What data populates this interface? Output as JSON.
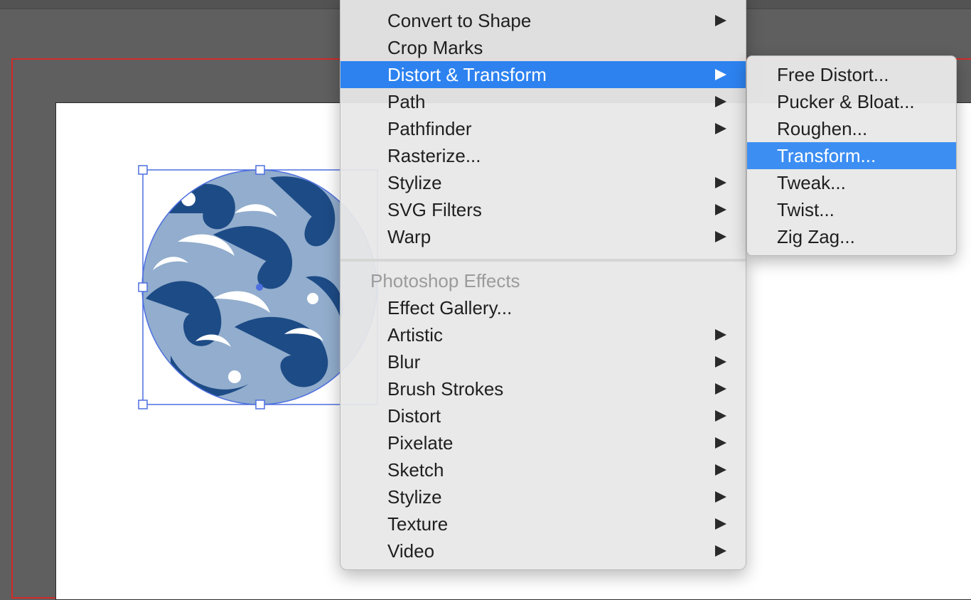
{
  "effect_menu": {
    "illustrator_items": [
      {
        "label": "Convert to Shape",
        "has_submenu": true
      },
      {
        "label": "Crop Marks",
        "has_submenu": false
      },
      {
        "label": "Distort & Transform",
        "has_submenu": true,
        "highlighted": true
      },
      {
        "label": "Path",
        "has_submenu": true
      },
      {
        "label": "Pathfinder",
        "has_submenu": true
      },
      {
        "label": "Rasterize...",
        "has_submenu": false
      },
      {
        "label": "Stylize",
        "has_submenu": true
      },
      {
        "label": "SVG Filters",
        "has_submenu": true
      },
      {
        "label": "Warp",
        "has_submenu": true
      }
    ],
    "photoshop_header": "Photoshop Effects",
    "photoshop_items": [
      {
        "label": "Effect Gallery...",
        "has_submenu": false
      },
      {
        "label": "Artistic",
        "has_submenu": true
      },
      {
        "label": "Blur",
        "has_submenu": true
      },
      {
        "label": "Brush Strokes",
        "has_submenu": true
      },
      {
        "label": "Distort",
        "has_submenu": true
      },
      {
        "label": "Pixelate",
        "has_submenu": true
      },
      {
        "label": "Sketch",
        "has_submenu": true
      },
      {
        "label": "Stylize",
        "has_submenu": true
      },
      {
        "label": "Texture",
        "has_submenu": true
      },
      {
        "label": "Video",
        "has_submenu": true
      }
    ]
  },
  "distort_submenu": {
    "items": [
      {
        "label": "Free Distort..."
      },
      {
        "label": "Pucker & Bloat..."
      },
      {
        "label": "Roughen..."
      },
      {
        "label": "Transform...",
        "highlighted": true
      },
      {
        "label": "Tweak..."
      },
      {
        "label": "Twist..."
      },
      {
        "label": "Zig Zag..."
      }
    ]
  },
  "colors": {
    "highlight": "#2d82f0",
    "bleed_guide": "#d42a2a",
    "selection": "#4d6fe0",
    "pattern_dark": "#1d4b86",
    "pattern_light": "#dbeefa"
  }
}
